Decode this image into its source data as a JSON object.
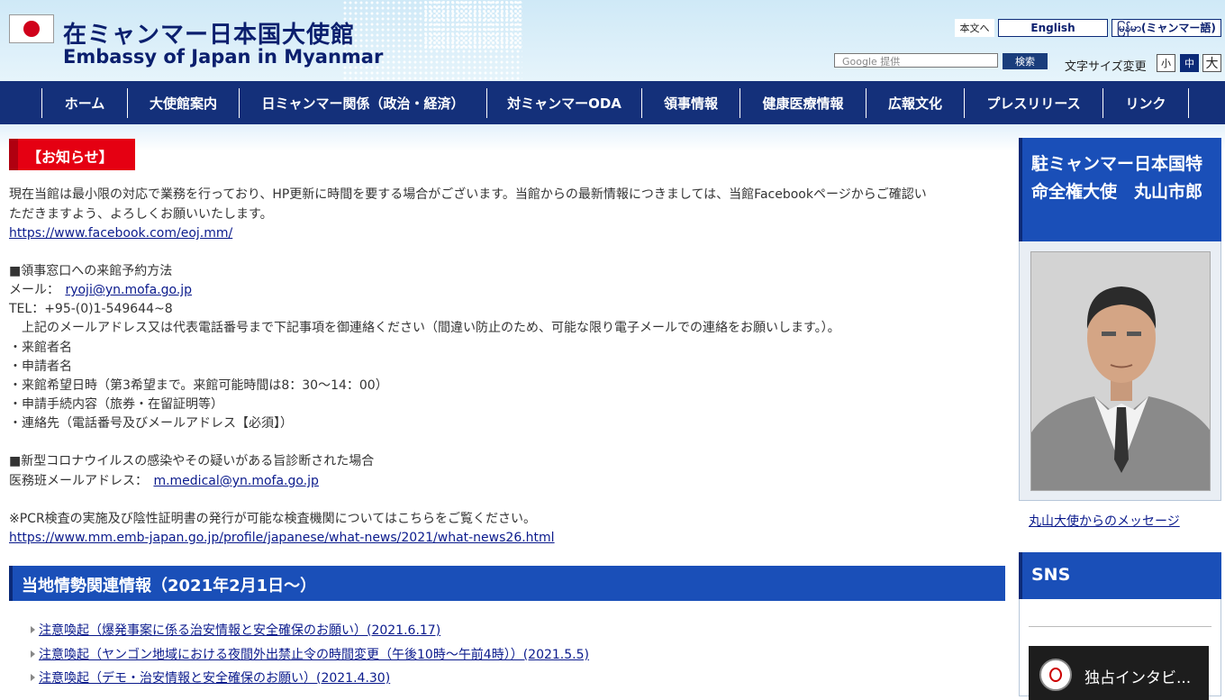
{
  "header": {
    "title_ja": "在ミャンマー日本国大使館",
    "title_en": "Embassy of Japan in Myanmar",
    "skip_link": "本文へ",
    "lang_english": "English",
    "lang_myanmar": "မြန်မာ(ミャンマー語)",
    "search_placeholder": "Google 提供",
    "search_button": "検索",
    "font_size_label": "文字サイズ変更",
    "font_small": "小",
    "font_medium": "中",
    "font_large": "大"
  },
  "nav": {
    "items": [
      {
        "label": "ホーム"
      },
      {
        "label": "大使館案内"
      },
      {
        "label": "日ミャンマー関係（政治・経済）"
      },
      {
        "label": "対ミャンマーODA"
      },
      {
        "label": "領事情報"
      },
      {
        "label": "健康医療情報"
      },
      {
        "label": "広報文化"
      },
      {
        "label": "プレスリリース"
      },
      {
        "label": "リンク"
      }
    ]
  },
  "notice": {
    "heading": "【お知らせ】",
    "para1_line1": "現在当館は最小限の対応で業務を行っており、HP更新に時間を要する場合がございます。当館からの最新情報につきましては、当館Facebookページからご確認い",
    "para1_line2": "ただきますよう、よろしくお願いいたします。",
    "facebook_link": "https://www.facebook.com/eoj.mm/",
    "consular_heading": "■領事窓口への来館予約方法",
    "mail_label": "メール：",
    "consular_email": "ryoji@yn.mofa.go.jp",
    "tel": "TEL：+95-(0)1-549644~8",
    "instruction": "　上記のメールアドレス又は代表電話番号まで下記事項を御連絡ください（間違い防止のため、可能な限り電子メールでの連絡をお願いします。）。",
    "items": [
      "・来館者名",
      "・申請者名",
      "・来館希望日時（第3希望まで。来館可能時間は8：30〜14：00）",
      "・申請手続内容（旅券・在留証明等）",
      "・連絡先（電話番号及びメールアドレス【必須】）"
    ],
    "covid_heading": "■新型コロナウイルスの感染やその疑いがある旨診断された場合",
    "medical_label": "医務班メールアドレス：",
    "medical_email": "m.medical@yn.mofa.go.jp",
    "pcr_note": "※PCR検査の実施及び陰性証明書の発行が可能な検査機関についてはこちらをご覧ください。",
    "pcr_link": "https://www.mm.emb-japan.go.jp/profile/japanese/what-news/2021/what-news26.html"
  },
  "local_info": {
    "heading": "当地情勢関連情報（2021年2月1日〜）",
    "links": [
      "注意喚起（爆発事案に係る治安情報と安全確保のお願い）(2021.6.17)",
      "注意喚起（ヤンゴン地域における夜間外出禁止令の時間変更（午後10時〜午前4時））(2021.5.5)",
      "注意喚起（デモ・治安情報と安全確保のお願い）(2021.4.30)"
    ]
  },
  "sidebar": {
    "ambassador_heading": "駐ミャンマー日本国特命全権大使　丸山市郎",
    "ambassador_message_link": "丸山大使からのメッセージ",
    "sns_heading": "SNS",
    "video_title": "独占インタビ..."
  }
}
